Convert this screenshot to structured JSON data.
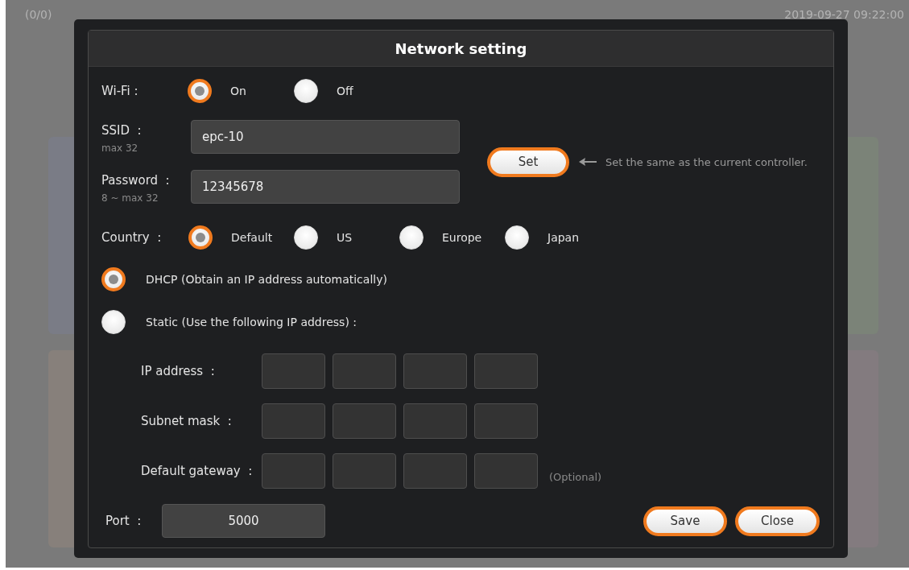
{
  "background": {
    "counter": "(0/0)",
    "datetime": "2019-09-27 09:22:00",
    "panels": [
      {
        "color": "#7a7c86"
      },
      {
        "color": "#7b8378"
      },
      {
        "color": "#87807b"
      },
      {
        "color": "#837b7f"
      }
    ]
  },
  "dialog": {
    "title": "Network setting",
    "wifi": {
      "label": "Wi-Fi :",
      "options": [
        {
          "label": "On",
          "selected": true
        },
        {
          "label": "Off",
          "selected": false
        }
      ]
    },
    "ssid": {
      "label": "SSID  :",
      "hint": "max 32",
      "value": "epc-10"
    },
    "password": {
      "label": "Password  :",
      "hint": "8 ~ max 32",
      "value": "12345678"
    },
    "set_button": "Set",
    "set_hint": "Set the same as the current controller.",
    "country": {
      "label": "Country  :",
      "options": [
        {
          "label": "Default",
          "selected": true
        },
        {
          "label": "US",
          "selected": false
        },
        {
          "label": "Europe",
          "selected": false
        },
        {
          "label": "Japan",
          "selected": false
        }
      ]
    },
    "ip_modes": [
      {
        "label": "DHCP (Obtain an IP address automatically)",
        "selected": true
      },
      {
        "label": "Static (Use the following IP address) :",
        "selected": false
      }
    ],
    "static_fields": [
      {
        "label": "IP address  :"
      },
      {
        "label": "Subnet mask  :"
      },
      {
        "label": "Default gateway  :",
        "note": "(Optional)"
      }
    ],
    "port": {
      "label": "Port  :",
      "value": "5000"
    },
    "buttons": [
      "Save",
      "Close"
    ]
  }
}
